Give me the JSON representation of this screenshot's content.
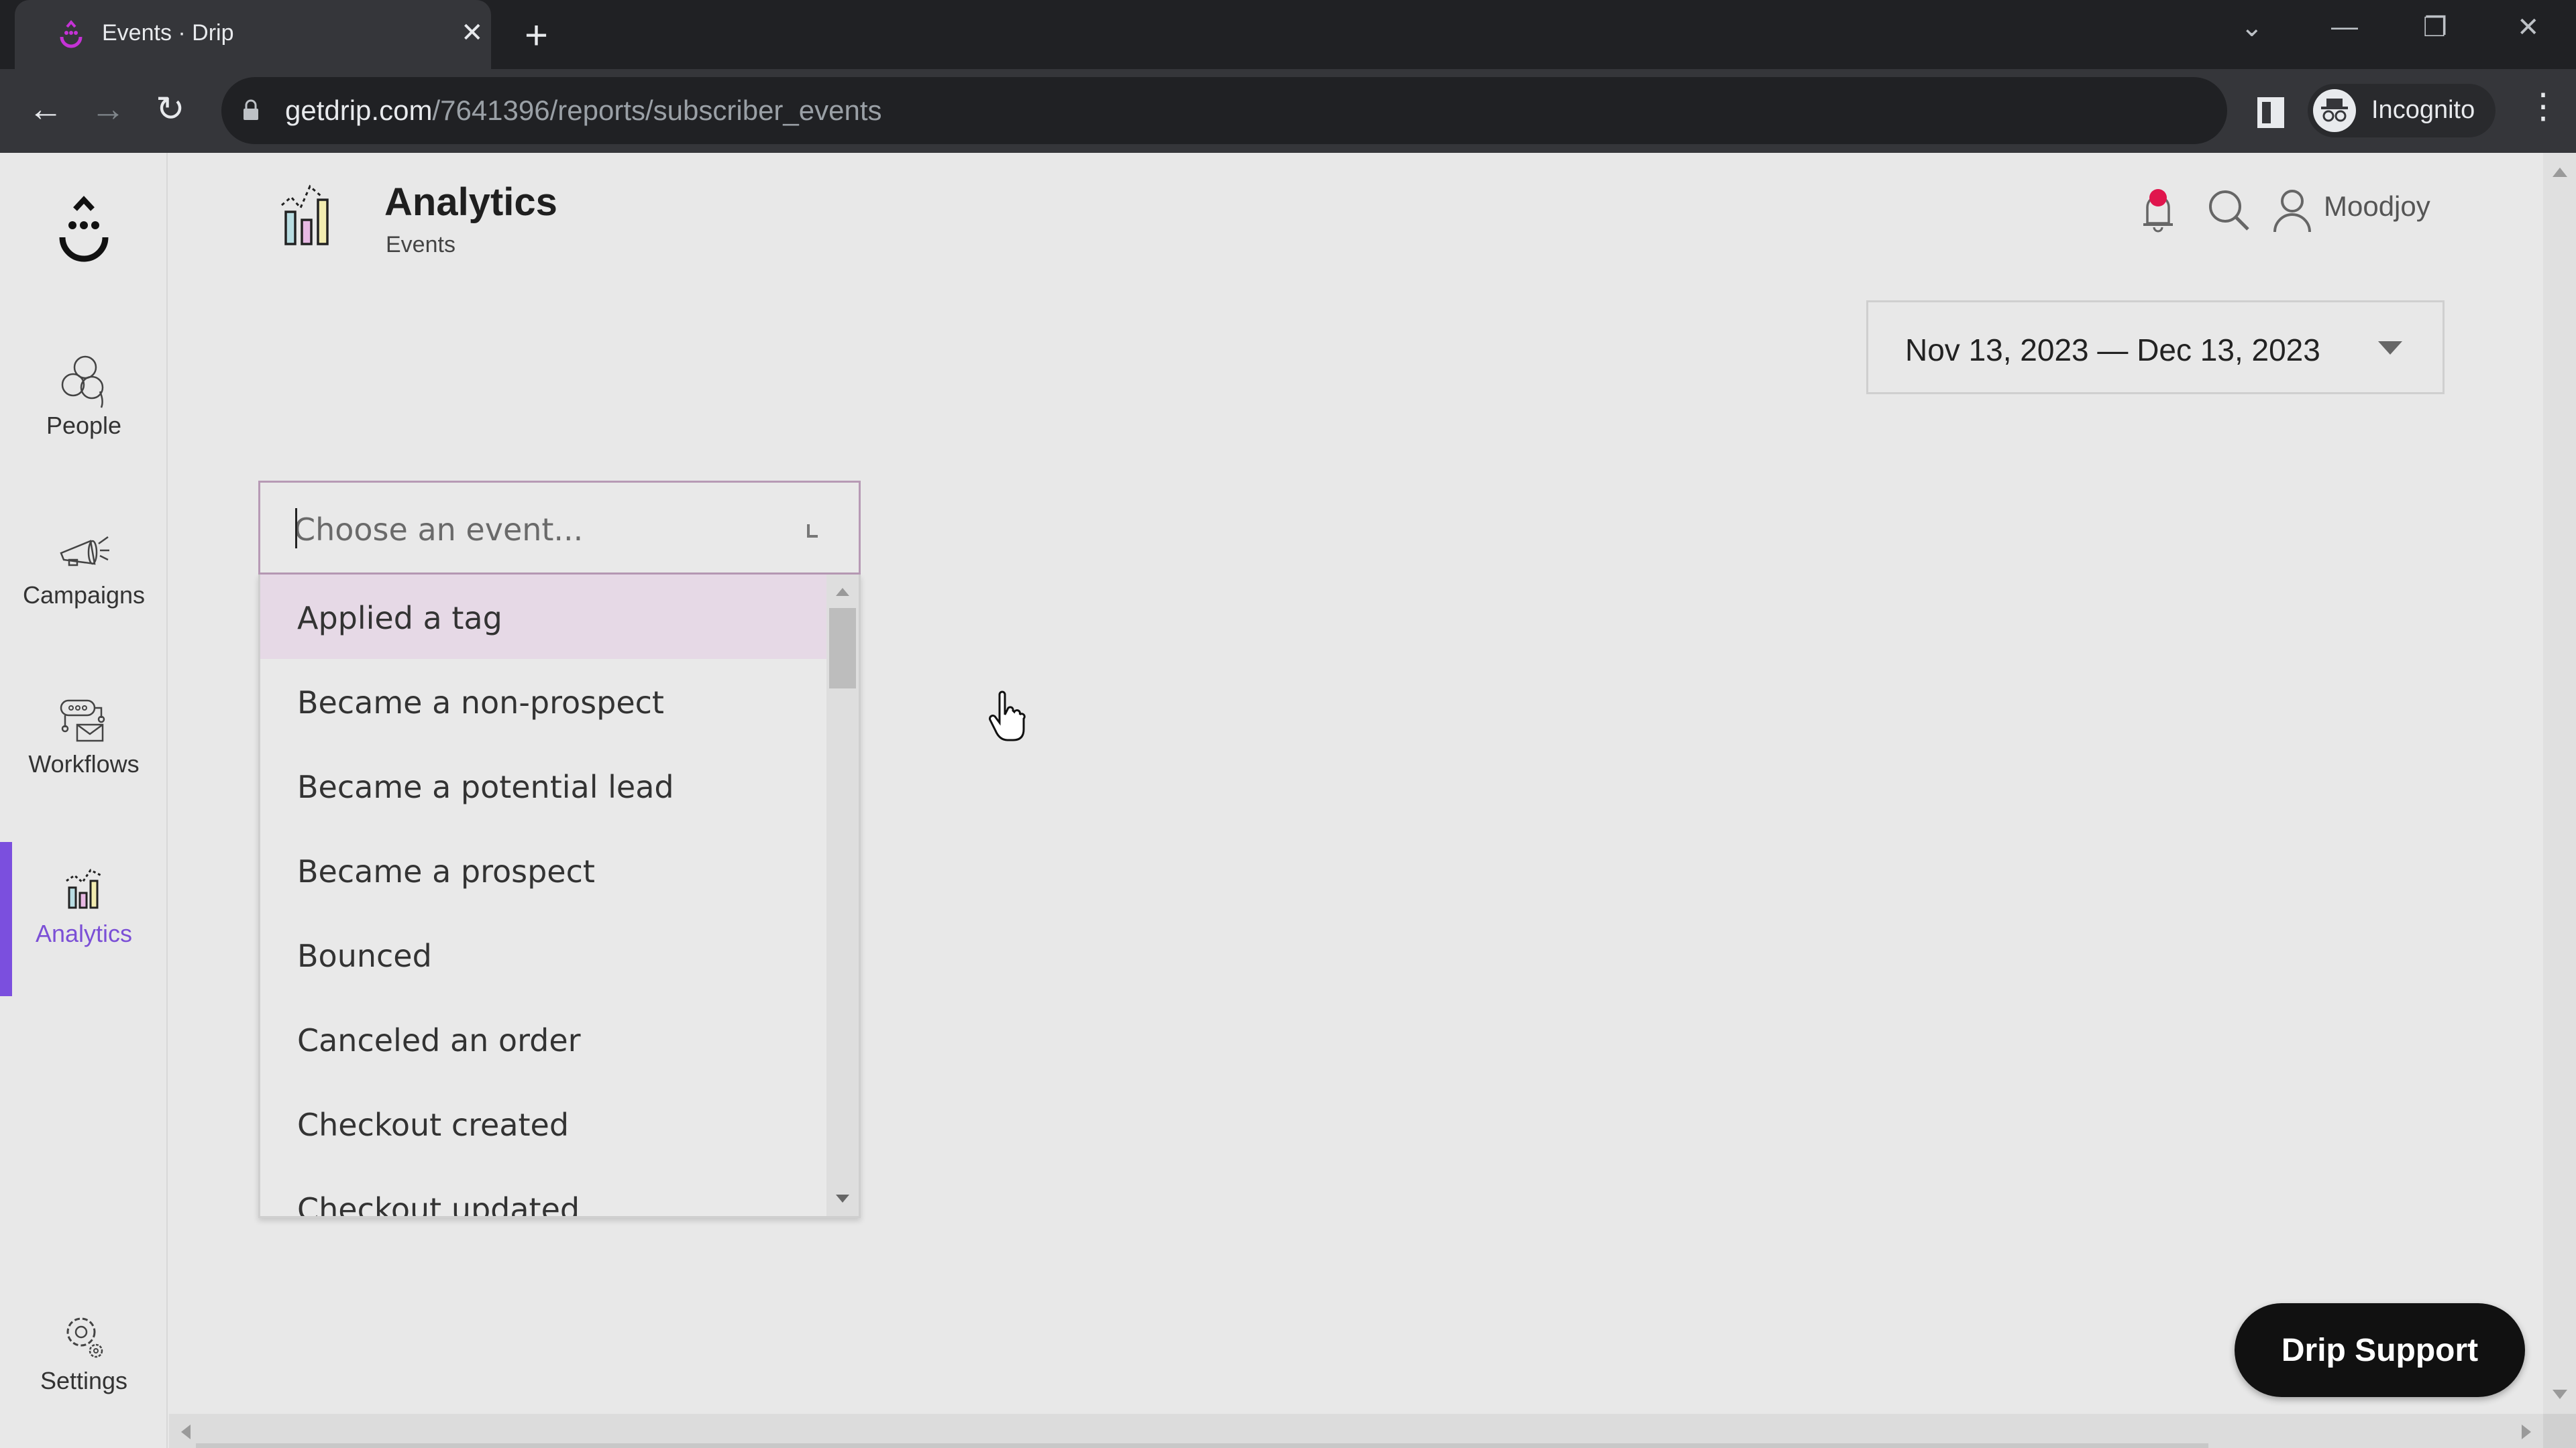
{
  "browser": {
    "tab_title": "Events · Drip",
    "url_host": "getdrip.com",
    "url_path": "/7641396/reports/subscriber_events",
    "profile_label": "Incognito"
  },
  "sidebar": {
    "items": [
      {
        "label": "People",
        "icon": "people-icon"
      },
      {
        "label": "Campaigns",
        "icon": "megaphone-icon"
      },
      {
        "label": "Workflows",
        "icon": "workflow-icon"
      },
      {
        "label": "Analytics",
        "icon": "analytics-icon",
        "active": true
      },
      {
        "label": "Settings",
        "icon": "gear-icon"
      }
    ]
  },
  "header": {
    "title": "Analytics",
    "subtitle": "Events",
    "user_name": "Moodjoy"
  },
  "date_range": {
    "value": "Nov 13, 2023 — Dec 13, 2023"
  },
  "event_select": {
    "placeholder": "Choose an event...",
    "value": "",
    "options": [
      "Applied a tag",
      "Became a non-prospect",
      "Became a potential lead",
      "Became a prospect",
      "Bounced",
      "Canceled an order",
      "Checkout created",
      "Checkout updated"
    ],
    "highlighted_index": 0
  },
  "support_button": {
    "label": "Drip Support"
  },
  "colors": {
    "accent": "#7b4fde",
    "notification": "#e0154d",
    "highlight": "#e6d9e6"
  }
}
